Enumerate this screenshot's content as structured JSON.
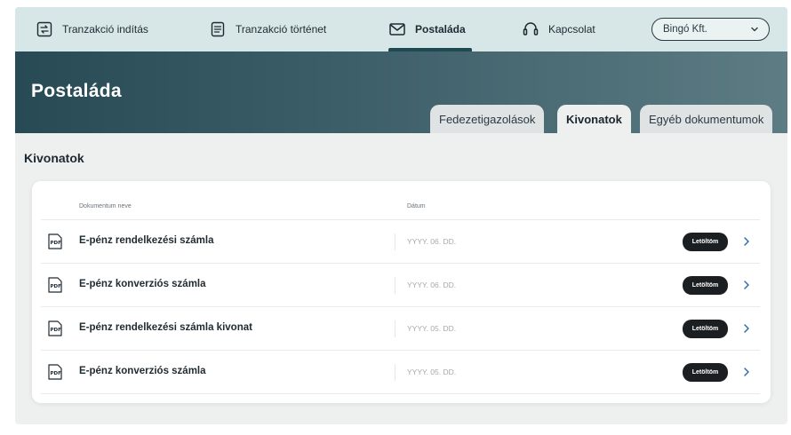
{
  "nav": {
    "items": [
      {
        "label": "Tranzakció indítás",
        "icon": "transfer-icon"
      },
      {
        "label": "Tranzakció történet",
        "icon": "document-list-icon"
      },
      {
        "label": "Postaláda",
        "icon": "envelope-icon",
        "active": true
      },
      {
        "label": "Kapcsolat",
        "icon": "headset-icon"
      }
    ],
    "company": "Bingó Kft."
  },
  "header": {
    "title": "Postaláda",
    "tabs": [
      {
        "label": "Fedezetigazolások"
      },
      {
        "label": "Kivonatok",
        "active": true
      },
      {
        "label": "Egyéb dokumentumok"
      }
    ]
  },
  "main": {
    "section_title": "Kivonatok",
    "columns": {
      "name": "Dokumentum neve",
      "date": "Dátum"
    },
    "rows": [
      {
        "name": "E-pénz rendelkezési számla",
        "date": "YYYY. 06. DD.",
        "action": "Letöltöm"
      },
      {
        "name": "E-pénz konverziós számla",
        "date": "YYYY. 06. DD.",
        "action": "Letöltöm"
      },
      {
        "name": "E-pénz rendelkezési számla kivonat",
        "date": "YYYY. 05. DD.",
        "action": "Letöltöm"
      },
      {
        "name": "E-pénz konverziós számla",
        "date": "YYYY. 05. DD.",
        "action": "Letöltöm"
      }
    ]
  },
  "colors": {
    "nav_bg": "#d7e6e6",
    "header_dark": "#274a55",
    "button_dark": "#1c1f21",
    "accent_arrow": "#2f6fa8"
  }
}
